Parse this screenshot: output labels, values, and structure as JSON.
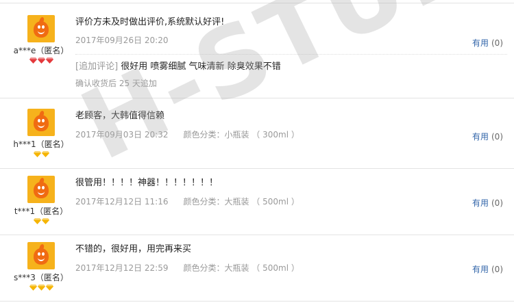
{
  "watermark": "H-STUDIO",
  "useful_label": "有用",
  "reviews": [
    {
      "user": "a***e（匿名）",
      "badge": "red",
      "badge_count": 3,
      "text": "评价方未及时做出评价,系统默认好评!",
      "date": "2017年09月26日 20:20",
      "sku": "",
      "useful_count": "(0)",
      "append_tag": "[追加评论]",
      "append_text": "很好用 喷雾细腻 气味清新 除臭效果不错",
      "append_note": "确认收货后 25 天追加"
    },
    {
      "user": "h***1（匿名）",
      "badge": "gold",
      "badge_count": 2,
      "text": "老顾客，大韩值得信赖",
      "date": "2017年09月03日 20:32",
      "sku": "颜色分类：小瓶装 （ 300ml ）",
      "useful_count": "(0)"
    },
    {
      "user": "t***1（匿名）",
      "badge": "gold",
      "badge_count": 2,
      "text": "很管用！！！！神器！！！！！！！",
      "date": "2017年12月12日 11:16",
      "sku": "颜色分类：大瓶装 （ 500ml ）",
      "useful_count": "(0)"
    },
    {
      "user": "s***3（匿名）",
      "badge": "gold",
      "badge_count": 3,
      "text": "不错的，很好用，用完再来买",
      "date": "2017年12月12日 22:59",
      "sku": "颜色分类：大瓶装 （ 500ml ）",
      "useful_count": "(0)"
    }
  ],
  "colors": {
    "red_badge": "#e4393c",
    "gold_badge": "#f5b400",
    "useful_link": "#3366aa"
  }
}
